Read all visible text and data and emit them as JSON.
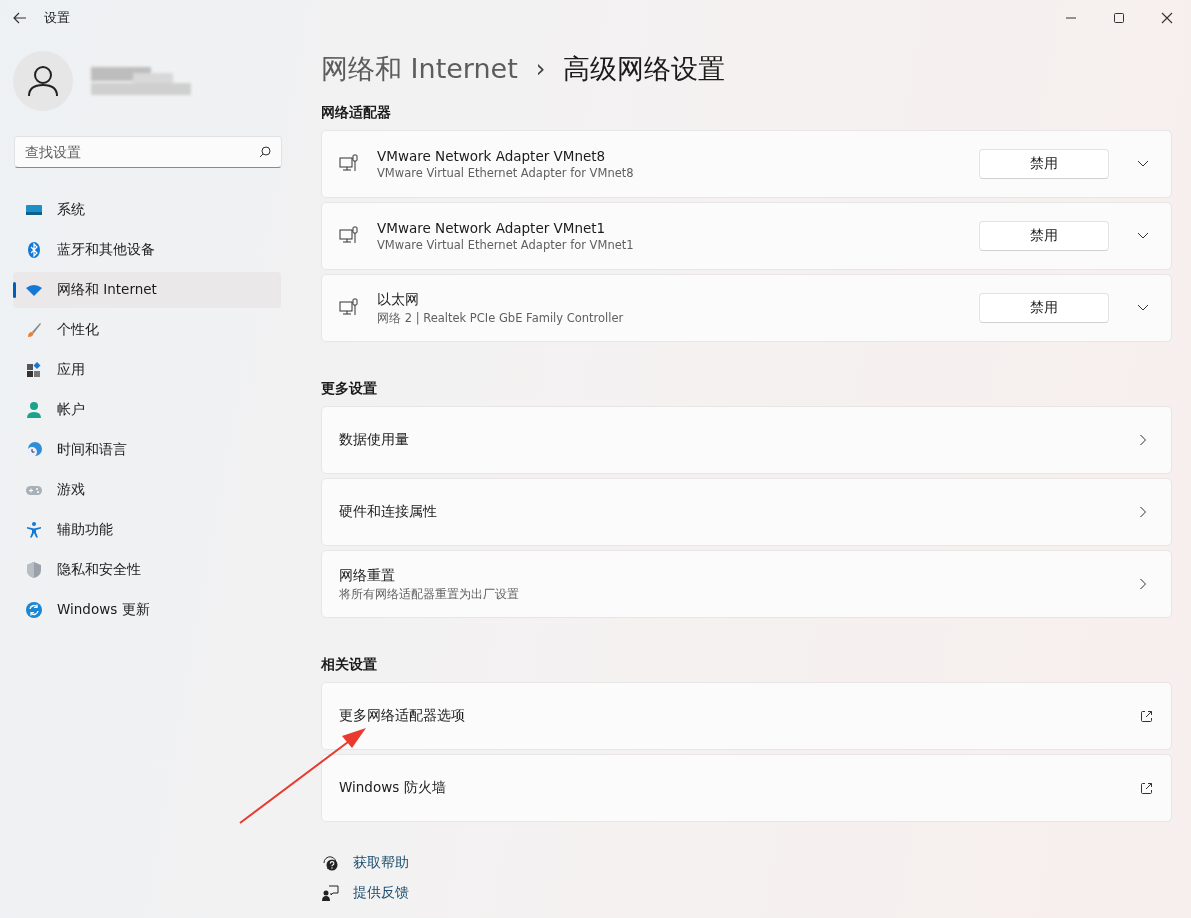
{
  "window": {
    "title": "设置"
  },
  "sidebar": {
    "search": {
      "placeholder": "查找设置"
    },
    "items": [
      {
        "label": "系统",
        "selected": false
      },
      {
        "label": "蓝牙和其他设备",
        "selected": false
      },
      {
        "label": "网络和 Internet",
        "selected": true
      },
      {
        "label": "个性化",
        "selected": false
      },
      {
        "label": "应用",
        "selected": false
      },
      {
        "label": "帐户",
        "selected": false
      },
      {
        "label": "时间和语言",
        "selected": false
      },
      {
        "label": "游戏",
        "selected": false
      },
      {
        "label": "辅助功能",
        "selected": false
      },
      {
        "label": "隐私和安全性",
        "selected": false
      },
      {
        "label": "Windows 更新",
        "selected": false
      }
    ]
  },
  "breadcrumb": {
    "parent": "网络和 Internet",
    "separator": "›",
    "current": "高级网络设置"
  },
  "sections": [
    {
      "heading": "网络适配器",
      "rows": [
        {
          "kind": "adapter",
          "title": "VMware Network Adapter VMnet8",
          "subtitle": "VMware Virtual Ethernet Adapter for VMnet8",
          "button": "禁用",
          "expanded": false
        },
        {
          "kind": "adapter",
          "title": "VMware Network Adapter VMnet1",
          "subtitle": "VMware Virtual Ethernet Adapter for VMnet1",
          "button": "禁用",
          "expanded": false
        },
        {
          "kind": "adapter",
          "title": "以太网",
          "subtitle": "网络 2 | Realtek PCIe GbE Family Controller",
          "button": "禁用",
          "expanded": false
        }
      ]
    },
    {
      "heading": "更多设置",
      "rows": [
        {
          "kind": "link",
          "title": "数据使用量"
        },
        {
          "kind": "link",
          "title": "硬件和连接属性"
        },
        {
          "kind": "link",
          "title": "网络重置",
          "subtitle": "将所有网络适配器重置为出厂设置"
        }
      ]
    },
    {
      "heading": "相关设置",
      "rows": [
        {
          "kind": "external",
          "title": "更多网络适配器选项"
        },
        {
          "kind": "external",
          "title": "Windows 防火墙"
        }
      ]
    }
  ],
  "footer_links": [
    {
      "kind": "help",
      "label": "获取帮助"
    },
    {
      "kind": "feedback",
      "label": "提供反馈"
    }
  ]
}
